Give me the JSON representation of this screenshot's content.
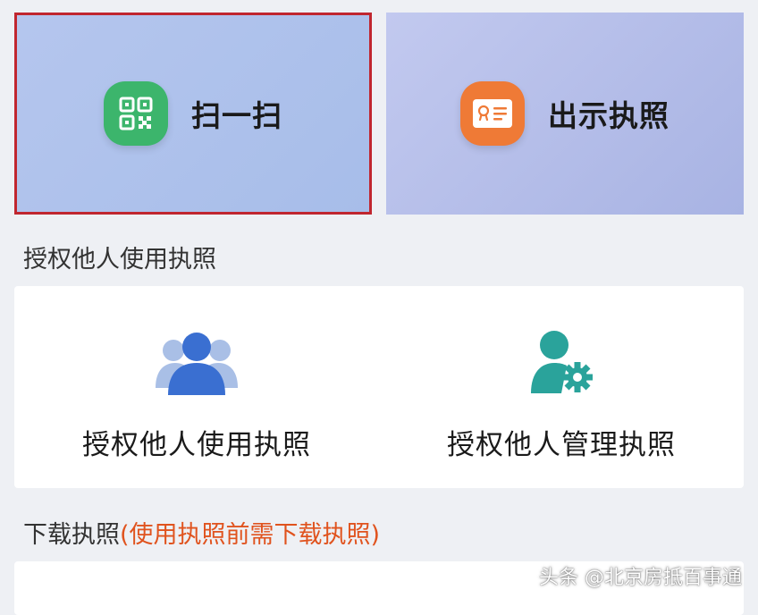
{
  "tiles": {
    "scan_label": "扫一扫",
    "show_license_label": "出示执照"
  },
  "sections": {
    "authorize_title": "授权他人使用执照",
    "download_title": "下载执照",
    "download_hint": "(使用执照前需下载执照)"
  },
  "authorize": {
    "use_label": "授权他人使用执照",
    "manage_label": "授权他人管理执照"
  },
  "watermark": "头条 @北京房抵百事通",
  "icons": {
    "scan": "qr-code-icon",
    "show_license": "license-card-icon",
    "use": "users-group-icon",
    "manage": "user-gear-icon"
  },
  "colors": {
    "scan_icon_bg": "#3cb56c",
    "license_icon_bg": "#ef7a36",
    "highlight_border": "#c0262f",
    "hint_text": "#e0531e",
    "user_icon_blue": "#3a6fd1",
    "user_icon_teal": "#2aa39b"
  }
}
